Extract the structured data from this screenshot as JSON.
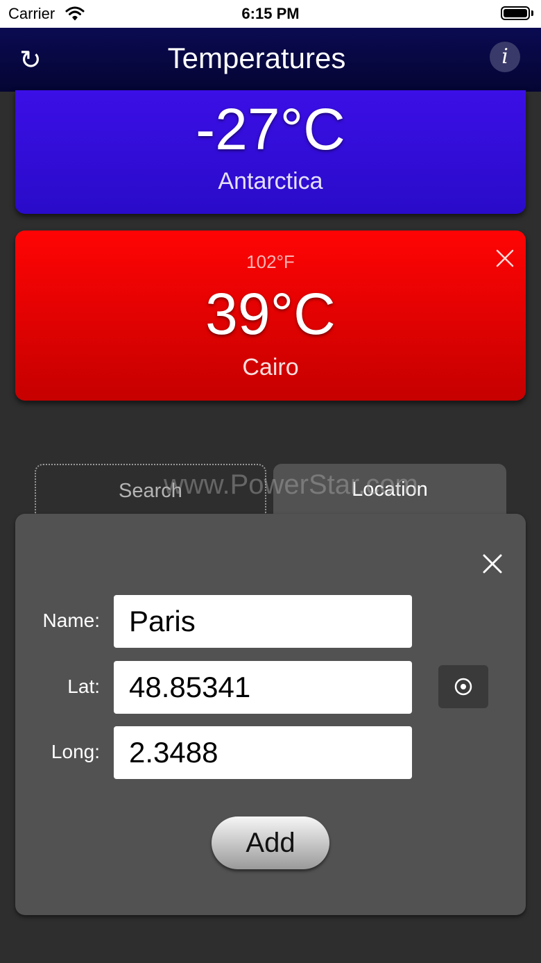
{
  "status_bar": {
    "carrier": "Carrier",
    "time": "6:15 PM"
  },
  "nav": {
    "title": "Temperatures",
    "refresh_icon": "refresh-icon",
    "info_label": "i"
  },
  "cards": [
    {
      "temperature": "-27°C",
      "city": "Antarctica",
      "color": "#3b0fe6"
    },
    {
      "fahrenheit": "102°F",
      "temperature": "39°C",
      "city": "Cairo",
      "color": "#ff0404"
    }
  ],
  "tabs": [
    {
      "label": "Search",
      "selected": false
    },
    {
      "label": "Location",
      "selected": true
    }
  ],
  "watermark": "www.PowerStar.com",
  "form": {
    "name_label": "Name:",
    "name_value": "Paris",
    "lat_label": "Lat:",
    "lat_value": "48.85341",
    "long_label": "Long:",
    "long_value": "2.3488",
    "add_label": "Add"
  }
}
